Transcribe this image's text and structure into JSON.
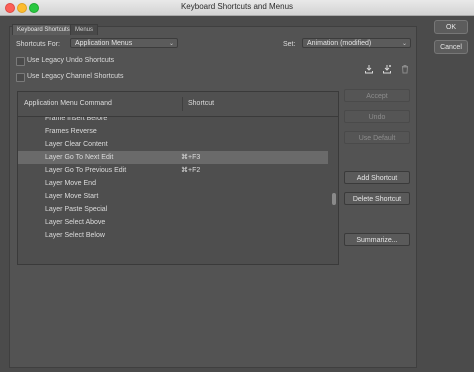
{
  "window": {
    "title": "Keyboard Shortcuts and Menus"
  },
  "tabs": [
    {
      "label": "Keyboard Shortcuts"
    },
    {
      "label": "Menus"
    }
  ],
  "form": {
    "shortcuts_for_label": "Shortcuts For:",
    "shortcuts_for_value": "Application Menus",
    "set_label": "Set:",
    "set_value": "Animation (modified)",
    "legacy_undo_label": "Use Legacy Undo Shortcuts",
    "legacy_channel_label": "Use Legacy Channel Shortcuts"
  },
  "table": {
    "col_command": "Application Menu Command",
    "col_shortcut": "Shortcut",
    "rows": [
      {
        "command": "Frame Insert Before",
        "shortcut": ""
      },
      {
        "command": "Frames Reverse",
        "shortcut": ""
      },
      {
        "command": "Layer Clear Content",
        "shortcut": ""
      },
      {
        "command": "Layer Go To Next Edit",
        "shortcut": "⌘+F3"
      },
      {
        "command": "Layer Go To Previous Edit",
        "shortcut": "⌘+F2"
      },
      {
        "command": "Layer Move End",
        "shortcut": ""
      },
      {
        "command": "Layer Move Start",
        "shortcut": ""
      },
      {
        "command": "Layer Paste Special",
        "shortcut": ""
      },
      {
        "command": "Layer Select Above",
        "shortcut": ""
      },
      {
        "command": "Layer Select Below",
        "shortcut": ""
      }
    ]
  },
  "buttons": {
    "accept": "Accept",
    "undo": "Undo",
    "use_default": "Use Default",
    "add_shortcut": "Add Shortcut",
    "delete_shortcut": "Delete Shortcut",
    "summarize": "Summarize...",
    "ok": "OK",
    "cancel": "Cancel"
  },
  "icons": {
    "save_set": "download-icon",
    "save_as": "save-as-icon",
    "delete_set": "trash-icon"
  }
}
